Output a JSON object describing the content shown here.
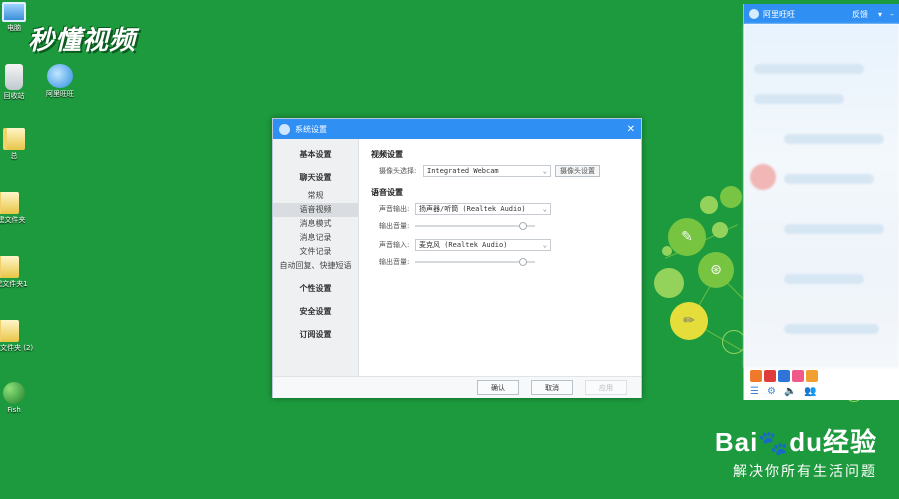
{
  "watermark": {
    "text": "秒懂视频"
  },
  "desktop": {
    "icons": [
      {
        "label": "电脑"
      },
      {
        "label": "回收站"
      },
      {
        "label": "阿里旺旺"
      },
      {
        "label": "总"
      },
      {
        "label": "新建文件夹"
      },
      {
        "label": "新建文件夹1"
      },
      {
        "label": "新建文件夹 (2)"
      },
      {
        "label": "Fish"
      }
    ]
  },
  "dialog": {
    "title": "系统设置",
    "close_glyph": "✕",
    "sidebar": {
      "basic": "基本设置",
      "chat": "聊天设置",
      "chat_items": [
        "常规",
        "语音视频",
        "消息模式",
        "消息记录",
        "文件记录",
        "自动回复、快捷短语"
      ],
      "personal": "个性设置",
      "security": "安全设置",
      "subscribe": "订阅设置"
    },
    "video": {
      "heading": "视频设置",
      "camera_label": "摄像头选择:",
      "camera_value": "Integrated Webcam",
      "camera_btn": "摄像头设置"
    },
    "audio": {
      "heading": "语音设置",
      "output_label": "声音输出:",
      "output_value": "扬声器/听筒 (Realtek Audio)",
      "output_volume_label": "输出音量:",
      "output_volume": 0.9,
      "input_label": "声音输入:",
      "input_value": "麦克风 (Realtek Audio)",
      "input_volume_label": "输出音量:",
      "input_volume": 0.9
    },
    "footer": {
      "ok": "确认",
      "cancel": "取消",
      "apply": "应用"
    }
  },
  "wangwang": {
    "title": "阿里旺旺",
    "feedback": "反馈",
    "app_colors": [
      "#f07a2c",
      "#e23b3b",
      "#2f74d9",
      "#ef5a8a",
      "#f0a030"
    ],
    "tool_glyphs": [
      "☰",
      "⚙",
      "🔈",
      "👥"
    ]
  },
  "baidu": {
    "brand": "Bai",
    "brand_mid": "du",
    "brand_suffix": "经验",
    "slogan": "解决你所有生活问题"
  }
}
